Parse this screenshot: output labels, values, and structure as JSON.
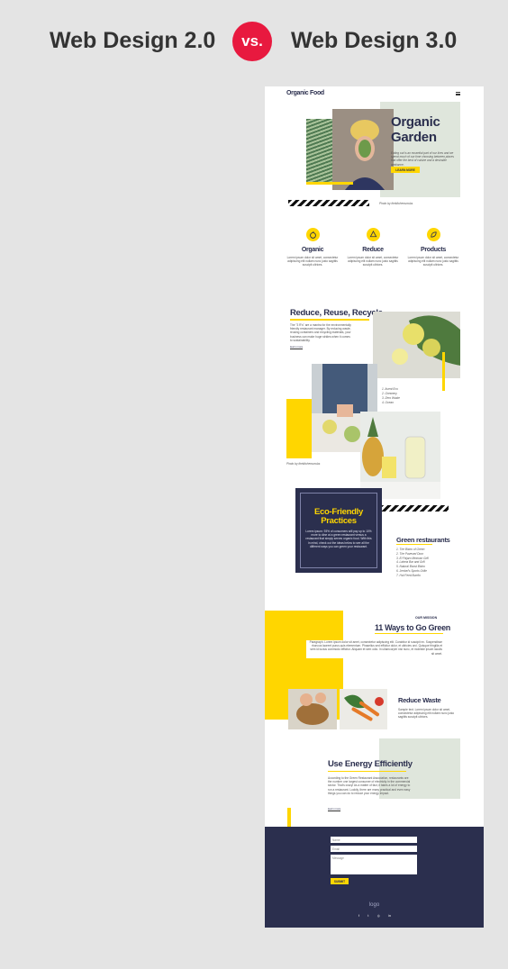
{
  "comparison": {
    "left_title": "Web Design 2.0",
    "vs": "vs.",
    "right_title": "Web Design 3.0"
  },
  "site": {
    "brand": "Organic Food",
    "menu_icon": "hamburger-icon",
    "hero": {
      "title_line1": "Organic",
      "title_line2": "Garden",
      "text": "Eating out is an essential part of our lives and we spend much of our time choosing between places that offer the best of cuisine and a desirable ambiance.",
      "button": "LEARN MORE",
      "credit": "Photo by thekitchenscrubs"
    },
    "features": [
      {
        "icon": "apple-icon",
        "title": "Organic",
        "text": "Lorem ipsum dolor sit amet, consectetur adipiscing elit nullam nunc justo sagittis suscipit ultrices."
      },
      {
        "icon": "recycle-icon",
        "title": "Reduce",
        "text": "Lorem ipsum dolor sit amet, consectetur adipiscing elit nullam nunc justo sagittis suscipit ultrices."
      },
      {
        "icon": "leaf-icon",
        "title": "Products",
        "text": "Lorem ipsum dolor sit amet, consectetur adipiscing elit nullam nunc justo sagittis suscipit ultrices."
      }
    ],
    "rrr": {
      "title": "Reduce, Reuse, Recycle",
      "text": "The \"3 R's\" are a mantra for the environmentally friendly restaurant manager. By reducing waste, reusing containers and recycling materials, your business can make huge strides when it comes to sustainability.",
      "link": "learn more",
      "list": [
        "1. Avent Eco",
        "2. Greenery",
        "3. Zero Waste",
        "4. Ocean"
      ],
      "credit": "Photo by thekitchenscrubs"
    },
    "eco": {
      "title_line1": "Eco-Friendly",
      "title_line2": "Practices",
      "text": "Lorem ipsum: 93% of consumers will pay up to 10% more to dine at a green restaurant versus a restaurant that simply serves organic food. With this in mind, check out the ideas below to see all the different ways you can green your restaurant."
    },
    "green_restaurants": {
      "title": "Green restaurants",
      "items": [
        "1. The Bistro of Green",
        "2. The Pavesed Door",
        "3. El Pajaro Mexican Grill",
        "4. Lalena Bar and Grill",
        "5. Natural Boost Bistro",
        "6. Jerrbel's Sports Grille",
        "7. Hot Feed Burrito"
      ]
    },
    "mission": {
      "label": "OUR MISSION",
      "title": "11 Ways to Go Green",
      "text": "Paragraph. Lorem ipsum dolor sit amet, consectetur adipiscing elit. Curabitur id suscipit ex. Suspendisse rhoncus laoreet purus quis elementum. Phasellus sed efficitur dolor, et ultricies orci. Quisque fringilla et sem id luctus commodo efficitur. Aliquam et sem odio. In ullamcorper nisi nunc, et molestie ipsum iaculis sit amet."
    },
    "reduce_waste": {
      "title": "Reduce Waste",
      "text": "Sample text. Lorem ipsum dolor sit amet, consectetur adipiscing elit nullam nunc justo sagittis suscipit ultrices."
    },
    "energy": {
      "title": "Use Energy Efficiently",
      "text": "According to the Green Restaurant Association, restaurants are the number one largest consumer of electricity in the commercial sector. That's crazy! As a matter of fact, it takes a lot of energy to run a restaurant. Luckily, there are many practical and even easy things you can do to reduce your energy impact.",
      "link": "learn more"
    },
    "footer": {
      "name_placeholder": "Name",
      "email_placeholder": "Email",
      "message_placeholder": "Message",
      "submit": "SUBMIT",
      "logo": "logo",
      "social": [
        "f",
        "t",
        "◎",
        "in"
      ]
    },
    "colors": {
      "accent": "#ffd600",
      "navy": "#2b2f4e",
      "sage": "#dfe6dc",
      "vs_red": "#e8193f"
    }
  }
}
